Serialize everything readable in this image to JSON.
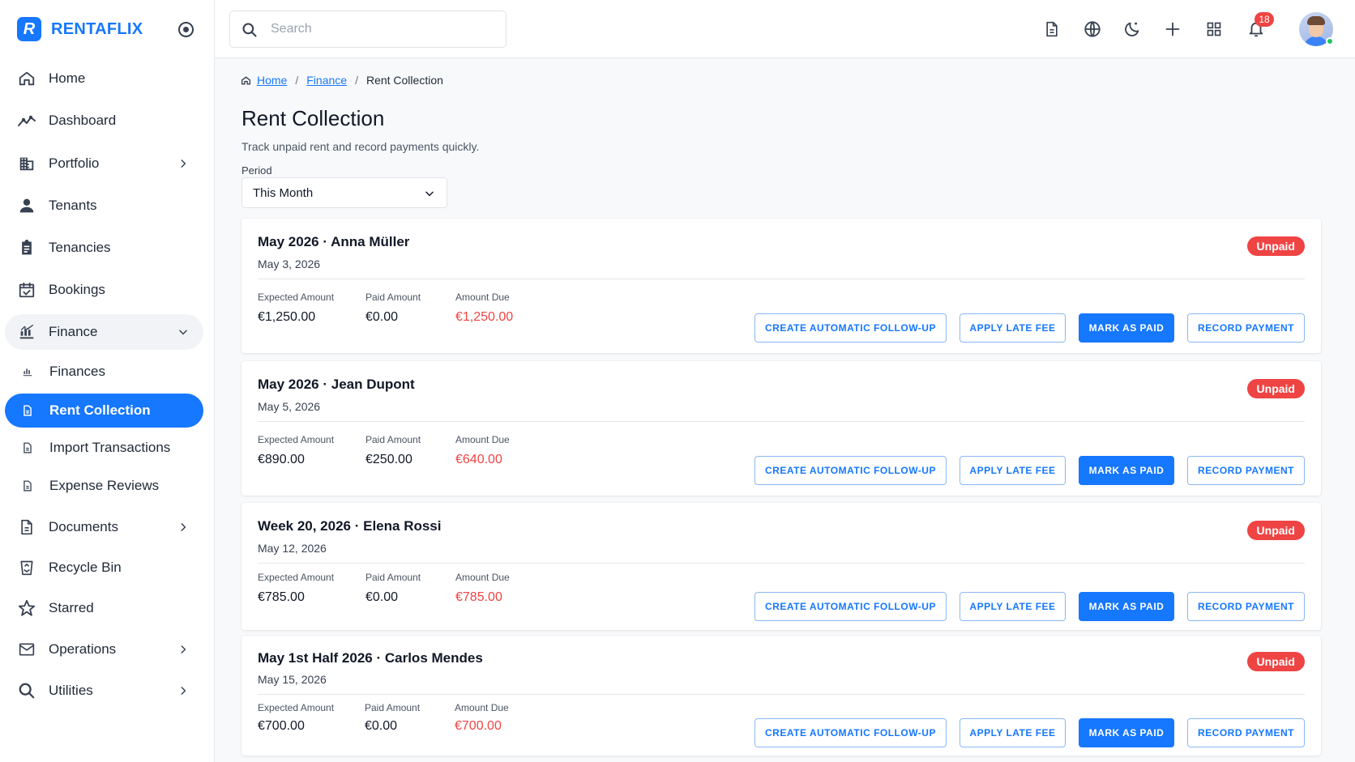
{
  "app": {
    "brand_letter": "R",
    "brand_name": "RENTAFLIX",
    "accent": "#1677ff",
    "danger": "#ef4444"
  },
  "sidebar": {
    "items": [
      {
        "label": "Home",
        "icon": "home-icon"
      },
      {
        "label": "Dashboard",
        "icon": "trend-icon"
      },
      {
        "label": "Portfolio",
        "icon": "building-icon"
      },
      {
        "label": "Tenants",
        "icon": "person-icon"
      },
      {
        "label": "Tenancies",
        "icon": "clipboard-icon"
      },
      {
        "label": "Bookings",
        "icon": "calendar-check-icon"
      },
      {
        "label": "Finance",
        "icon": "finance-chart-icon"
      },
      {
        "label": "Finances",
        "icon": "finance-chart-icon"
      },
      {
        "label": "Rent Collection",
        "icon": "document-icon"
      },
      {
        "label": "Import Transactions",
        "icon": "document-icon"
      },
      {
        "label": "Expense Reviews",
        "icon": "document-icon"
      },
      {
        "label": "Documents",
        "icon": "document-icon"
      },
      {
        "label": "Recycle Bin",
        "icon": "recycle-bin-icon"
      },
      {
        "label": "Starred",
        "icon": "star-icon"
      },
      {
        "label": "Operations",
        "icon": "mail-icon"
      },
      {
        "label": "Utilities",
        "icon": "search-icon"
      }
    ]
  },
  "topbar": {
    "search_placeholder": "Search",
    "notification_count": "18"
  },
  "breadcrumb": {
    "home": "Home",
    "finance": "Finance",
    "current": "Rent Collection"
  },
  "page": {
    "title": "Rent Collection",
    "subtitle": "Track unpaid rent and record payments quickly.",
    "period_label": "Period",
    "period_value": "This Month"
  },
  "labels": {
    "expected": "Expected Amount",
    "paid": "Paid Amount",
    "due": "Amount Due",
    "btn_followup": "CREATE AUTOMATIC FOLLOW-UP",
    "btn_late_fee": "APPLY LATE FEE",
    "btn_mark_paid": "MARK AS PAID",
    "btn_record": "RECORD PAYMENT"
  },
  "records": [
    {
      "period": "May 2026",
      "tenant": "Anna Müller",
      "date": "May 3, 2026",
      "status": "Unpaid",
      "expected": "€1,250.00",
      "paid": "€0.00",
      "due": "€1,250.00"
    },
    {
      "period": "May 2026",
      "tenant": "Jean Dupont",
      "date": "May 5, 2026",
      "status": "Unpaid",
      "expected": "€890.00",
      "paid": "€250.00",
      "due": "€640.00"
    },
    {
      "period": "Week 20, 2026",
      "tenant": "Elena Rossi",
      "date": "May 12, 2026",
      "status": "Unpaid",
      "expected": "€785.00",
      "paid": "€0.00",
      "due": "€785.00"
    },
    {
      "period": "May 1st Half 2026",
      "tenant": "Carlos Mendes",
      "date": "May 15, 2026",
      "status": "Unpaid",
      "expected": "€700.00",
      "paid": "€0.00",
      "due": "€700.00"
    }
  ]
}
